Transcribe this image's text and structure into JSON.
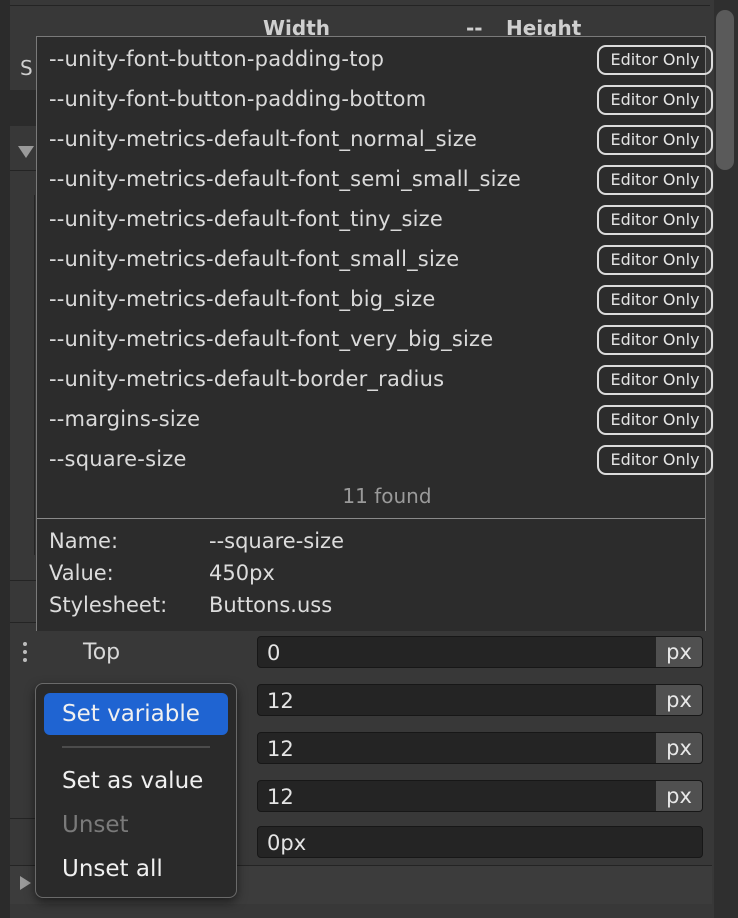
{
  "background": {
    "header_width_label": "Width",
    "header_dash": "--",
    "header_height_label": "Height",
    "left_letter": "S",
    "property": {
      "label": "Top",
      "fields": [
        {
          "value": "0",
          "unit": "px"
        },
        {
          "value": "12",
          "unit": "px"
        },
        {
          "value": "12",
          "unit": "px"
        },
        {
          "value": "12",
          "unit": "px"
        },
        {
          "value": "0px",
          "unit": ""
        }
      ]
    }
  },
  "variable_popup": {
    "badge_label": "Editor Only",
    "variables": [
      "--unity-font-button-padding-top",
      "--unity-font-button-padding-bottom",
      "--unity-metrics-default-font_normal_size",
      "--unity-metrics-default-font_semi_small_size",
      "--unity-metrics-default-font_tiny_size",
      "--unity-metrics-default-font_small_size",
      "--unity-metrics-default-font_big_size",
      "--unity-metrics-default-font_very_big_size",
      "--unity-metrics-default-border_radius",
      "--margins-size",
      "--square-size"
    ],
    "found_text": "11 found",
    "details": {
      "name_key": "Name:",
      "name_value": "--square-size",
      "value_key": "Value:",
      "value_value": "450px",
      "stylesheet_key": "Stylesheet:",
      "stylesheet_value": "Buttons.uss"
    }
  },
  "context_menu": {
    "items": [
      {
        "label": "Set variable",
        "state": "active"
      },
      {
        "label": "Set as value",
        "state": "normal"
      },
      {
        "label": "Unset",
        "state": "disabled"
      },
      {
        "label": "Unset all",
        "state": "normal"
      }
    ]
  },
  "colors": {
    "accent": "#1f64d2",
    "panel": "#2c2c2c",
    "background": "#383838"
  }
}
